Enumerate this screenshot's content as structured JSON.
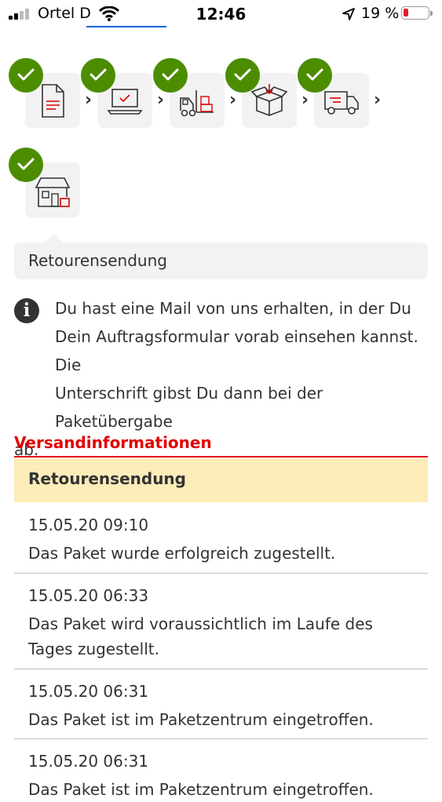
{
  "status_bar": {
    "carrier": "Ortel D",
    "time": "12:46",
    "battery_percent": "19 %",
    "battery_color": "#e31e24"
  },
  "steps": [
    {
      "name": "document-icon",
      "done": true
    },
    {
      "name": "laptop-icon",
      "done": true
    },
    {
      "name": "forklift-icon",
      "done": true
    },
    {
      "name": "box-icon",
      "done": true
    },
    {
      "name": "truck-icon",
      "done": true
    },
    {
      "name": "house-icon",
      "done": true
    }
  ],
  "current_step_label": "Retourensendung",
  "info": {
    "icon": "info-icon",
    "lines": [
      "Du hast eine Mail von uns erhalten, in der Du",
      "Dein Auftragsformular vorab einsehen kannst. Die",
      "Unterschrift gibst Du dann bei der Paketübergabe",
      "ab."
    ]
  },
  "shipping": {
    "title": "Versandinformationen",
    "accent_color": "#e00000",
    "header_bg": "#fbecb8",
    "table_header": "Retourensendung",
    "events": [
      {
        "timestamp": "15.05.20 09:10",
        "message": "Das Paket wurde erfolgreich zugestellt."
      },
      {
        "timestamp": "15.05.20 06:33",
        "message": "Das Paket wird voraussichtlich im Laufe des Tages zugestellt."
      },
      {
        "timestamp": "15.05.20 06:31",
        "message": "Das Paket ist im Paketzentrum eingetroffen."
      },
      {
        "timestamp": "15.05.20 06:31",
        "message": "Das Paket ist im Paketzentrum eingetroffen."
      }
    ]
  }
}
